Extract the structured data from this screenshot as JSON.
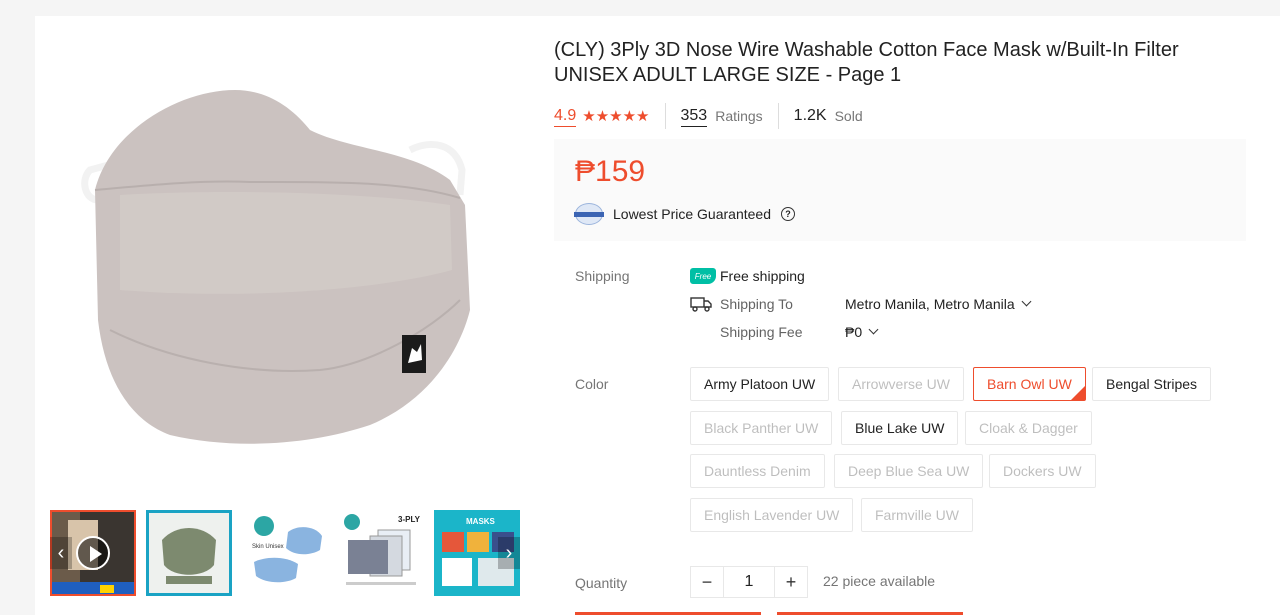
{
  "product": {
    "title": "(CLY) 3Ply 3D Nose Wire Washable Cotton Face Mask w/Built-In Filter UNISEX ADULT LARGE SIZE - Page 1",
    "rating": "4.9",
    "stars": "★★★★★",
    "ratings_count": "353",
    "ratings_label": "Ratings",
    "sold_count": "1.2K",
    "sold_label": "Sold",
    "price": "₱159",
    "guarantee": "Lowest Price Guaranteed",
    "guarantee_help": "?"
  },
  "shipping": {
    "label": "Shipping",
    "free_tag": "Free",
    "free_text": "Free shipping",
    "to_label": "Shipping To",
    "to_value": "Metro Manila, Metro Manila",
    "fee_label": "Shipping Fee",
    "fee_value": "₱0"
  },
  "color": {
    "label": "Color",
    "options": [
      {
        "label": "Army Platoon UW",
        "state": "normal"
      },
      {
        "label": "Arrowverse UW",
        "state": "disabled"
      },
      {
        "label": "Barn Owl UW",
        "state": "selected"
      },
      {
        "label": "Bengal Stripes",
        "state": "normal"
      },
      {
        "label": "Black Panther UW",
        "state": "disabled"
      },
      {
        "label": "Blue Lake UW",
        "state": "normal"
      },
      {
        "label": "Cloak & Dagger",
        "state": "disabled"
      },
      {
        "label": "Dauntless Denim",
        "state": "disabled"
      },
      {
        "label": "Deep Blue Sea UW",
        "state": "disabled"
      },
      {
        "label": "Dockers UW",
        "state": "disabled"
      },
      {
        "label": "English Lavender UW",
        "state": "disabled"
      },
      {
        "label": "Farmville UW",
        "state": "disabled"
      }
    ]
  },
  "quantity": {
    "label": "Quantity",
    "minus": "−",
    "plus": "+",
    "value": "1",
    "available": "22 piece available"
  },
  "gallery": {
    "arrow_left": "‹",
    "arrow_right": "›",
    "thumb3_text": "Skin Unisex",
    "thumb4_text": "3-PLY",
    "thumb5_text": "MASKS"
  },
  "colors": {
    "accent": "#ee4d2d",
    "mask": "#cbc2c0",
    "free_tag": "#00bfa5"
  }
}
